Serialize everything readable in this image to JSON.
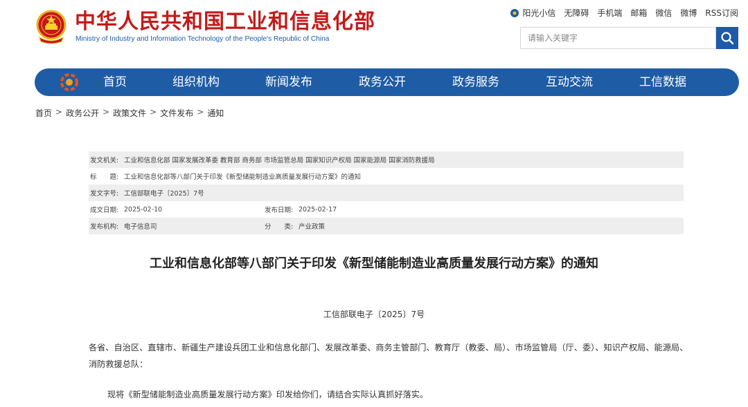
{
  "header": {
    "title": "中华人民共和国工业和信息化部",
    "subtitle": "Ministry of Industry and Information Technology of the People's Republic of China",
    "top_links": [
      "阳光小信",
      "无障碍",
      "手机端",
      "邮箱",
      "微信",
      "微博",
      "RSS订阅"
    ],
    "search_placeholder": "请输入关键字"
  },
  "nav": {
    "items": [
      "首页",
      "组织机构",
      "新闻发布",
      "政务公开",
      "政务服务",
      "互动交流",
      "工信数据"
    ]
  },
  "breadcrumb": [
    "首页",
    "政务公开",
    "政策文件",
    "文件发布",
    "通知"
  ],
  "meta": {
    "issuer_label": "发文机关:",
    "issuer": "工业和信息化部 国家发展改革委 教育部 商务部 市场监管总局 国家知识产权局 国家能源局 国家消防救援局",
    "title_label": "标　　题:",
    "title": "工业和信息化部等八部门关于印发《新型储能制造业高质量发展行动方案》的通知",
    "docno_label": "发文字号:",
    "docno": "工信部联电子〔2025〕7号",
    "date_label": "成文日期:",
    "date": "2025-02-10",
    "pubdate_label": "发布日期:",
    "pubdate": "2025-02-17",
    "org_label": "发布机构:",
    "org": "电子信息司",
    "category_label": "分　　类:",
    "category": "产业政策"
  },
  "article": {
    "title": "工业和信息化部等八部门关于印发《新型储能制造业高质量发展行动方案》的通知",
    "doc_number": "工信部联电子〔2025〕7号",
    "recipients": "各省、自治区、直辖市、新疆生产建设兵团工业和信息化部门、发展改革委、商务主管部门、教育厅（教委、局）、市场监管局（厅、委）、知识产权局、能源局、消防救援总队：",
    "body": "现将《新型储能制造业高质量发展行动方案》印发给你们，请结合实际认真抓好落实。"
  },
  "colors": {
    "nav_blue": "#1f5ca6",
    "title_red": "#c41a1a",
    "subtitle_blue": "#1e5aa8"
  }
}
